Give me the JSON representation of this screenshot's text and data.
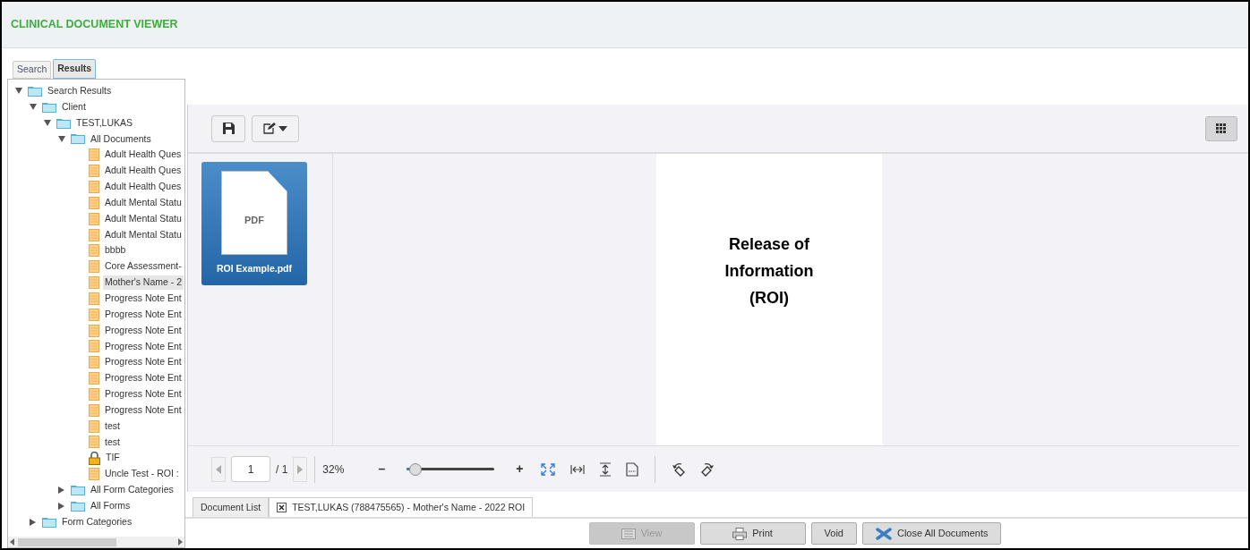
{
  "header": {
    "title": "CLINICAL DOCUMENT VIEWER"
  },
  "side_tabs": [
    {
      "label": "Search",
      "selected": false
    },
    {
      "label": "Results",
      "selected": true
    }
  ],
  "tree": [
    {
      "label": "Search Results",
      "kind": "folder",
      "expanded": true,
      "selected": false,
      "children": [
        {
          "label": "Client",
          "kind": "folder",
          "expanded": true,
          "selected": false,
          "children": [
            {
              "label": "TEST,LUKAS",
              "kind": "folder",
              "expanded": true,
              "selected": false,
              "children": [
                {
                  "label": "All Documents",
                  "kind": "folder",
                  "expanded": true,
                  "selected": false,
                  "children": [
                    {
                      "label": "Adult Health Ques",
                      "kind": "doc",
                      "selected": false
                    },
                    {
                      "label": "Adult Health Ques",
                      "kind": "doc",
                      "selected": false
                    },
                    {
                      "label": "Adult Health Ques",
                      "kind": "doc",
                      "selected": false
                    },
                    {
                      "label": "Adult Mental Statu",
                      "kind": "doc",
                      "selected": false
                    },
                    {
                      "label": "Adult Mental Statu",
                      "kind": "doc",
                      "selected": false
                    },
                    {
                      "label": "Adult Mental Statu",
                      "kind": "doc",
                      "selected": false
                    },
                    {
                      "label": "bbbb",
                      "kind": "doc",
                      "selected": false
                    },
                    {
                      "label": "Core Assessment-",
                      "kind": "doc",
                      "selected": false
                    },
                    {
                      "label": "Mother's Name - 2",
                      "kind": "doc",
                      "selected": true
                    },
                    {
                      "label": "Progress Note Ent",
                      "kind": "doc",
                      "selected": false
                    },
                    {
                      "label": "Progress Note Ent",
                      "kind": "doc",
                      "selected": false
                    },
                    {
                      "label": "Progress Note Ent",
                      "kind": "doc",
                      "selected": false
                    },
                    {
                      "label": "Progress Note Ent",
                      "kind": "doc",
                      "selected": false
                    },
                    {
                      "label": "Progress Note Ent",
                      "kind": "doc",
                      "selected": false
                    },
                    {
                      "label": "Progress Note Ent",
                      "kind": "doc",
                      "selected": false
                    },
                    {
                      "label": "Progress Note Ent",
                      "kind": "doc",
                      "selected": false
                    },
                    {
                      "label": "Progress Note Ent",
                      "kind": "doc",
                      "selected": false
                    },
                    {
                      "label": "test",
                      "kind": "doc",
                      "selected": false
                    },
                    {
                      "label": "test",
                      "kind": "doc",
                      "selected": false
                    },
                    {
                      "label": "TIF",
                      "kind": "lock",
                      "selected": false
                    },
                    {
                      "label": "Uncle Test  - ROI :",
                      "kind": "doc",
                      "selected": false
                    }
                  ]
                },
                {
                  "label": "All Form Categories",
                  "kind": "folder",
                  "expanded": false,
                  "selected": false
                },
                {
                  "label": "All Forms",
                  "kind": "folder",
                  "expanded": false,
                  "selected": false
                }
              ]
            }
          ]
        },
        {
          "label": "Form Categories",
          "kind": "folder",
          "expanded": false,
          "selected": false
        }
      ]
    }
  ],
  "thumbnails": [
    {
      "type": "PDF",
      "name": "ROI Example.pdf",
      "selected": true
    }
  ],
  "page": {
    "lines": [
      "Release of",
      "Information",
      "(ROI)"
    ]
  },
  "pager": {
    "page": "1",
    "total": "/ 1",
    "zoom": "32%",
    "minus": "–",
    "plus": "+",
    "level": 0.1
  },
  "doc_tabs": [
    {
      "label": "Document List",
      "closable": false,
      "selected": false
    },
    {
      "label": "TEST,LUKAS (788475565) - Mother's Name - 2022 ROI",
      "closable": true,
      "selected": true
    }
  ],
  "buttons": [
    {
      "label": "View",
      "kind": "list",
      "disabled": true
    },
    {
      "label": "Print",
      "kind": "print",
      "disabled": false
    },
    {
      "label": "Void",
      "kind": "plain",
      "disabled": false
    },
    {
      "label": "Close All Documents",
      "kind": "close",
      "disabled": false
    }
  ]
}
